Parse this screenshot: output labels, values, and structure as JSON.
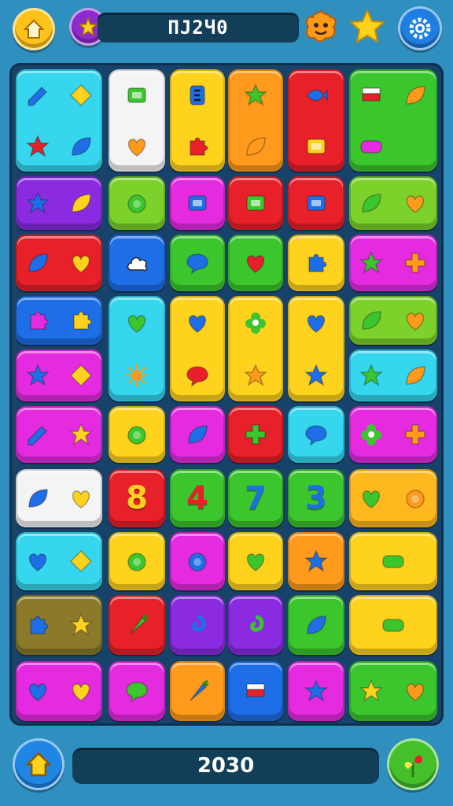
{
  "top_bar": {
    "score": "ПJ2Ч0",
    "home_icon": "home-icon",
    "star_icon": "star-icon",
    "buddy_icon": "orange-buddy-icon",
    "bonus_star_icon": "yellow-star-icon",
    "settings_icon": "gear-icon"
  },
  "bottom_bar": {
    "score": "2030",
    "home_icon": "home-icon",
    "bonus_icon": "heart-plant-icon"
  },
  "tiles": [
    {
      "id": "t1",
      "color": "#35d6ee",
      "icons": [
        "pencil-icon",
        "diamond-icon",
        "star-icon",
        "leaf-icon"
      ]
    },
    {
      "id": "t2",
      "color": "#f4f4f4",
      "icons": [
        "card-icon",
        "heart-icon"
      ]
    },
    {
      "id": "t3",
      "color": "#ffd21e",
      "icons": [
        "letter-e-icon",
        "puzzle-icon"
      ]
    },
    {
      "id": "t4",
      "color": "#ff9a1c",
      "icons": [
        "star-icon",
        "leaf-icon"
      ]
    },
    {
      "id": "t5",
      "color": "#e8202a",
      "icons": [
        "fish-icon",
        "box-icon"
      ]
    },
    {
      "id": "t6",
      "color": "#3cc62e",
      "icons": [
        "flag-icon",
        "leaf-icon",
        "sign-icon"
      ]
    },
    {
      "id": "t7",
      "color": "#8a2be2",
      "icons": [
        "star-icon",
        "leaf-icon"
      ]
    },
    {
      "id": "t8",
      "color": "#7cd12a",
      "icons": [
        "orange-icon"
      ]
    },
    {
      "id": "t9",
      "color": "#e52be0",
      "icons": [
        "tape-icon"
      ]
    },
    {
      "id": "t10",
      "color": "#e8202a",
      "icons": [
        "box-icon"
      ]
    },
    {
      "id": "t11",
      "color": "#e8202a",
      "icons": [
        "tv-icon"
      ]
    },
    {
      "id": "t12",
      "color": "#7cd12a",
      "icons": [
        "leaf-icon",
        "heart-icon"
      ]
    },
    {
      "id": "t13",
      "color": "#e8202a",
      "icons": [
        "leaf-icon",
        "heart-icon"
      ]
    },
    {
      "id": "t14",
      "color": "#1e6ee8",
      "icons": [
        "cloud-icon"
      ]
    },
    {
      "id": "t15",
      "color": "#3cc62e",
      "icons": [
        "speech-bubble-icon"
      ]
    },
    {
      "id": "t16",
      "color": "#3cc62e",
      "icons": [
        "heart-icon"
      ]
    },
    {
      "id": "t17",
      "color": "#ffd21e",
      "icons": [
        "puzzle-icon"
      ]
    },
    {
      "id": "t18",
      "color": "#e52be0",
      "icons": [
        "star-icon",
        "plus-icon"
      ]
    },
    {
      "id": "t19",
      "color": "#1e6ee8",
      "icons": [
        "puzzle-icon",
        "puzzle-icon"
      ]
    },
    {
      "id": "t20",
      "color": "#35d6ee",
      "icons": [
        "heart-icon",
        "sun-icon"
      ]
    },
    {
      "id": "t21",
      "color": "#ffd21e",
      "icons": [
        "heart-icon",
        "speech-bubble-icon"
      ]
    },
    {
      "id": "t22",
      "color": "#ffd21e",
      "icons": [
        "flower-icon",
        "star-icon"
      ]
    },
    {
      "id": "t23",
      "color": "#ffd21e",
      "icons": [
        "heart-icon",
        "star-icon"
      ]
    },
    {
      "id": "t24",
      "color": "#7cd12a",
      "icons": [
        "leaf-icon",
        "heart-icon"
      ]
    },
    {
      "id": "t25",
      "color": "#e52be0",
      "icons": [
        "star-icon",
        "diamond-icon"
      ]
    },
    {
      "id": "t26",
      "color": "#35d6ee",
      "icons": [
        "star-icon",
        "leaf-icon"
      ]
    },
    {
      "id": "t27",
      "color": "#e52be0",
      "icons": [
        "tag-icon",
        "star-icon"
      ]
    },
    {
      "id": "t28",
      "color": "#ffd21e",
      "icons": [
        "magnifier-icon"
      ]
    },
    {
      "id": "t29",
      "color": "#e52be0",
      "icons": [
        "leaf-icon"
      ]
    },
    {
      "id": "t30",
      "color": "#e8202a",
      "icons": [
        "plus-icon"
      ]
    },
    {
      "id": "t31",
      "color": "#35d6ee",
      "icons": [
        "speech-bubble-icon"
      ]
    },
    {
      "id": "t32",
      "color": "#e52be0",
      "icons": [
        "flower-icon",
        "plus-icon"
      ]
    },
    {
      "id": "t33",
      "color": "#f4f4f4",
      "icons": [
        "leaf-icon",
        "heart-icon"
      ]
    },
    {
      "id": "t34",
      "color": "#e8202a",
      "number": "8",
      "numcolor": "#ffd21e"
    },
    {
      "id": "t35",
      "color": "#3cc62e",
      "number": "4",
      "numcolor": "#e8202a"
    },
    {
      "id": "t36",
      "color": "#3cc62e",
      "number": "7",
      "numcolor": "#1e6ee8"
    },
    {
      "id": "t37",
      "color": "#3cc62e",
      "number": "3",
      "numcolor": "#1e6ee8"
    },
    {
      "id": "t38",
      "color": "#ffb81e",
      "icons": [
        "heart-icon",
        "apple-icon"
      ]
    },
    {
      "id": "t39",
      "color": "#35d6ee",
      "icons": [
        "heart-icon",
        "diamond-icon"
      ]
    },
    {
      "id": "t40",
      "color": "#ffd21e",
      "icons": [
        "ring-icon"
      ]
    },
    {
      "id": "t41",
      "color": "#e52be0",
      "icons": [
        "zero-icon"
      ]
    },
    {
      "id": "t42",
      "color": "#ffd21e",
      "icons": [
        "heart-icon"
      ]
    },
    {
      "id": "t43",
      "color": "#ff9a1c",
      "icons": [
        "star-icon"
      ]
    },
    {
      "id": "t44",
      "color": "#ffd21e",
      "icons": [
        "sign-icon"
      ]
    },
    {
      "id": "t45",
      "color": "#8a7a2a",
      "icons": [
        "puzzle-icon",
        "star-icon"
      ]
    },
    {
      "id": "t46",
      "color": "#e8202a",
      "icons": [
        "carrot-icon"
      ]
    },
    {
      "id": "t47",
      "color": "#8a2be2",
      "icons": [
        "swirl-icon"
      ]
    },
    {
      "id": "t48",
      "color": "#8a2be2",
      "icons": [
        "swirl-icon"
      ]
    },
    {
      "id": "t49",
      "color": "#3cc62e",
      "icons": [
        "leaf-icon"
      ]
    },
    {
      "id": "t50",
      "color": "#ffd21e",
      "icons": [
        "bread-icon"
      ]
    },
    {
      "id": "t51",
      "color": "#e52be0",
      "icons": [
        "heart-icon",
        "heart-icon"
      ]
    },
    {
      "id": "t52",
      "color": "#e52be0",
      "icons": [
        "speech-bubble-icon"
      ]
    },
    {
      "id": "t53",
      "color": "#ff9a1c",
      "icons": [
        "tree-icon"
      ]
    },
    {
      "id": "t54",
      "color": "#1e6ee8",
      "icons": [
        "flag-icon"
      ]
    },
    {
      "id": "t55",
      "color": "#e52be0",
      "icons": [
        "star-icon"
      ]
    },
    {
      "id": "t56",
      "color": "#3cc62e",
      "icons": [
        "star-icon",
        "heart-icon"
      ]
    }
  ]
}
